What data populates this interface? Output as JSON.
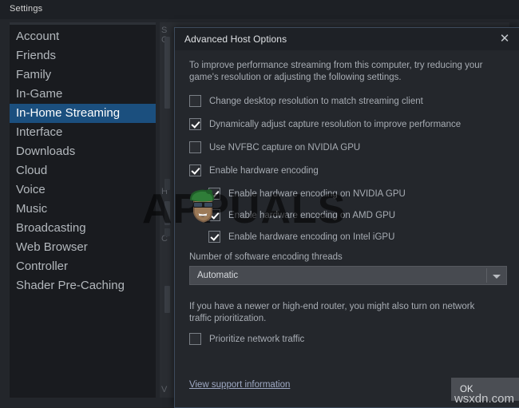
{
  "window": {
    "title": "Settings"
  },
  "sidebar": {
    "items": [
      {
        "label": "Account",
        "selected": false
      },
      {
        "label": "Friends",
        "selected": false
      },
      {
        "label": "Family",
        "selected": false
      },
      {
        "label": "In-Game",
        "selected": false
      },
      {
        "label": "In-Home Streaming",
        "selected": true
      },
      {
        "label": "Interface",
        "selected": false
      },
      {
        "label": "Downloads",
        "selected": false
      },
      {
        "label": "Cloud",
        "selected": false
      },
      {
        "label": "Voice",
        "selected": false
      },
      {
        "label": "Music",
        "selected": false
      },
      {
        "label": "Broadcasting",
        "selected": false
      },
      {
        "label": "Web Browser",
        "selected": false
      },
      {
        "label": "Controller",
        "selected": false
      },
      {
        "label": "Shader Pre-Caching",
        "selected": false
      }
    ]
  },
  "background_panel": {
    "ghost_lines": [
      "S",
      "C",
      "H",
      "C",
      "V"
    ]
  },
  "dialog": {
    "title": "Advanced Host Options",
    "close_icon": "close-icon",
    "intro": "To improve performance streaming from this computer, try reducing your game's resolution or adjusting the following settings.",
    "options": [
      {
        "label": "Change desktop resolution to match streaming client",
        "checked": false,
        "indent": false
      },
      {
        "label": "Dynamically adjust capture resolution to improve performance",
        "checked": true,
        "indent": false
      },
      {
        "label": "Use NVFBC capture on NVIDIA GPU",
        "checked": false,
        "indent": false
      },
      {
        "label": "Enable hardware encoding",
        "checked": true,
        "indent": false
      },
      {
        "label": "Enable hardware encoding on NVIDIA GPU",
        "checked": true,
        "indent": true
      },
      {
        "label": "Enable hardware encoding on AMD GPU",
        "checked": true,
        "indent": true
      },
      {
        "label": "Enable hardware encoding on Intel iGPU",
        "checked": true,
        "indent": true
      }
    ],
    "threads": {
      "label": "Number of software encoding threads",
      "value": "Automatic",
      "arrow_icon": "chevron-down-icon"
    },
    "router_note": "If you have a newer or high-end router, you might also turn on network traffic prioritization.",
    "prioritize": {
      "label": "Prioritize network traffic",
      "checked": false
    },
    "support_link": "View support information",
    "ok_label": "OK"
  },
  "watermarks": {
    "appuals": "APPUALS",
    "wsxdn": "wsxdn.com"
  },
  "colors": {
    "selection_blue": "#1b4f7e",
    "dialog_border": "#3d4b5c",
    "link": "#9fa9c4"
  }
}
